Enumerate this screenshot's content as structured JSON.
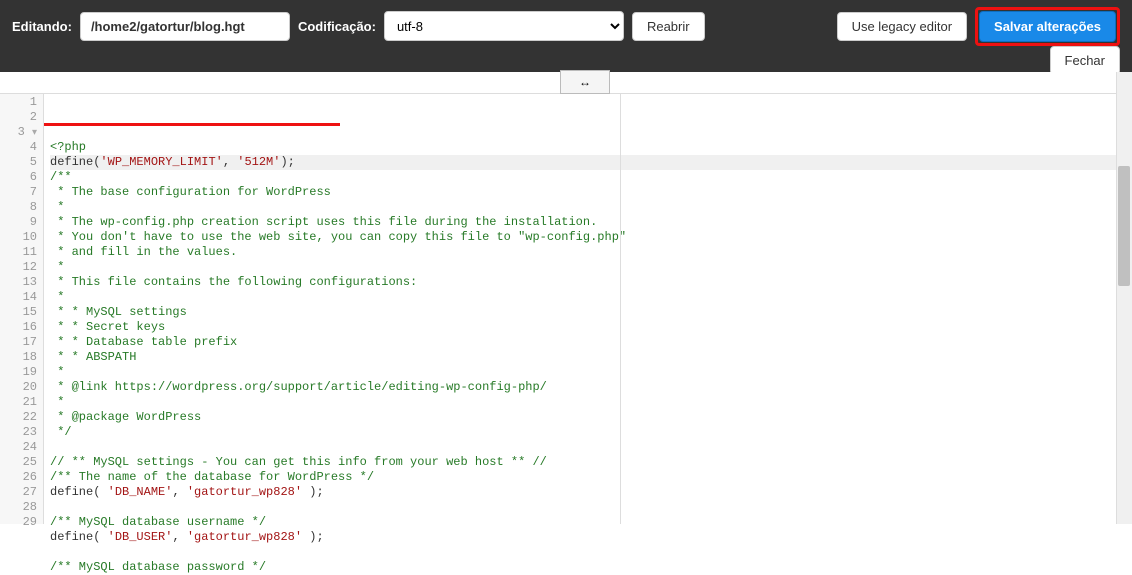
{
  "header": {
    "editing_label": "Editando:",
    "file_path": "/home2/gatortur/blog.hgt",
    "encoding_label": "Codificação:",
    "encoding_value": "utf-8",
    "reopen_btn": "Reabrir",
    "legacy_btn": "Use legacy editor",
    "save_btn": "Salvar alterações",
    "close_btn": "Fechar"
  },
  "toolbar": {
    "arrow_icon": "↔"
  },
  "code": {
    "lines": [
      {
        "n": 1,
        "type": "php",
        "c": "<?php"
      },
      {
        "n": 2,
        "type": "define",
        "fn": "define",
        "s1": "'WP_MEMORY_LIMIT'",
        "s2": "'512M'"
      },
      {
        "n": 3,
        "type": "cmt",
        "c": "/**",
        "fold": true
      },
      {
        "n": 4,
        "type": "cmt",
        "c": " * The base configuration for WordPress"
      },
      {
        "n": 5,
        "type": "cmt",
        "c": " *"
      },
      {
        "n": 6,
        "type": "cmt",
        "c": " * The wp-config.php creation script uses this file during the installation."
      },
      {
        "n": 7,
        "type": "cmt",
        "c": " * You don't have to use the web site, you can copy this file to \"wp-config.php\""
      },
      {
        "n": 8,
        "type": "cmt",
        "c": " * and fill in the values."
      },
      {
        "n": 9,
        "type": "cmt",
        "c": " *"
      },
      {
        "n": 10,
        "type": "cmt",
        "c": " * This file contains the following configurations:"
      },
      {
        "n": 11,
        "type": "cmt",
        "c": " *"
      },
      {
        "n": 12,
        "type": "cmt",
        "c": " * * MySQL settings"
      },
      {
        "n": 13,
        "type": "cmt",
        "c": " * * Secret keys"
      },
      {
        "n": 14,
        "type": "cmt",
        "c": " * * Database table prefix"
      },
      {
        "n": 15,
        "type": "cmt",
        "c": " * * ABSPATH"
      },
      {
        "n": 16,
        "type": "cmt",
        "c": " *"
      },
      {
        "n": 17,
        "type": "cmt",
        "c": " * @link https://wordpress.org/support/article/editing-wp-config-php/"
      },
      {
        "n": 18,
        "type": "cmt",
        "c": " *"
      },
      {
        "n": 19,
        "type": "cmt",
        "c": " * @package WordPress"
      },
      {
        "n": 20,
        "type": "cmt",
        "c": " */"
      },
      {
        "n": 21,
        "type": "blank",
        "c": ""
      },
      {
        "n": 22,
        "type": "cmt",
        "c": "// ** MySQL settings - You can get this info from your web host ** //"
      },
      {
        "n": 23,
        "type": "cmt",
        "c": "/** The name of the database for WordPress */"
      },
      {
        "n": 24,
        "type": "define",
        "fn": "define",
        "s1": "'DB_NAME'",
        "s2": "'gatortur_wp828'",
        "sp": true
      },
      {
        "n": 25,
        "type": "blank",
        "c": ""
      },
      {
        "n": 26,
        "type": "cmt",
        "c": "/** MySQL database username */"
      },
      {
        "n": 27,
        "type": "define",
        "fn": "define",
        "s1": "'DB_USER'",
        "s2": "'gatortur_wp828'",
        "sp": true
      },
      {
        "n": 28,
        "type": "blank",
        "c": ""
      },
      {
        "n": 29,
        "type": "cmt",
        "c": "/** MySQL database password */"
      }
    ]
  }
}
